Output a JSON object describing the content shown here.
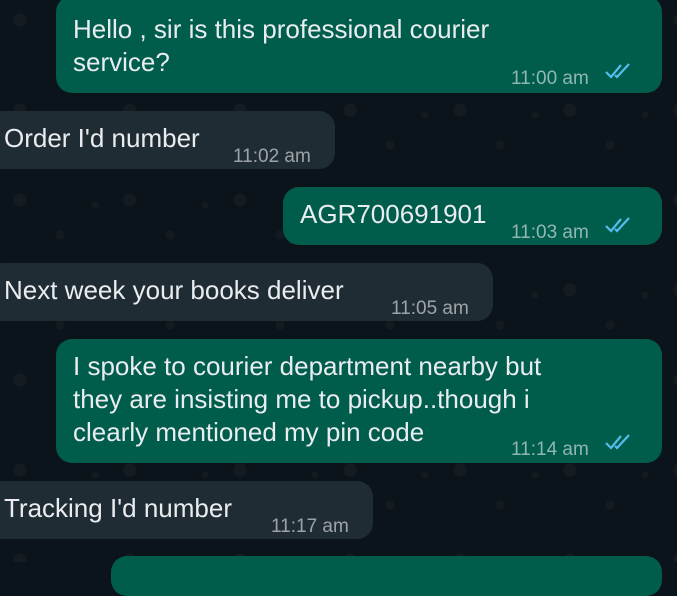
{
  "messages": [
    {
      "direction": "outgoing",
      "text": "Hello , sir is this professional courier\nservice?",
      "time": "11:00 am",
      "status": "read"
    },
    {
      "direction": "incoming",
      "text": "Order I'd number",
      "time": "11:02 am"
    },
    {
      "direction": "outgoing",
      "text": "AGR700691901",
      "time": "11:03 am",
      "status": "read"
    },
    {
      "direction": "incoming",
      "text": "Next week your books deliver",
      "time": "11:05 am"
    },
    {
      "direction": "outgoing",
      "text": "I spoke to courier department nearby but\nthey are insisting me to pickup..though i\nclearly mentioned my pin code",
      "time": "11:14 am",
      "status": "read"
    },
    {
      "direction": "incoming",
      "text": "Tracking I'd number",
      "time": "11:17 am"
    }
  ],
  "colors": {
    "outgoing_bubble": "#005c4b",
    "incoming_bubble": "#202c33",
    "read_ticks": "#53bdeb",
    "background": "#0b141a"
  }
}
